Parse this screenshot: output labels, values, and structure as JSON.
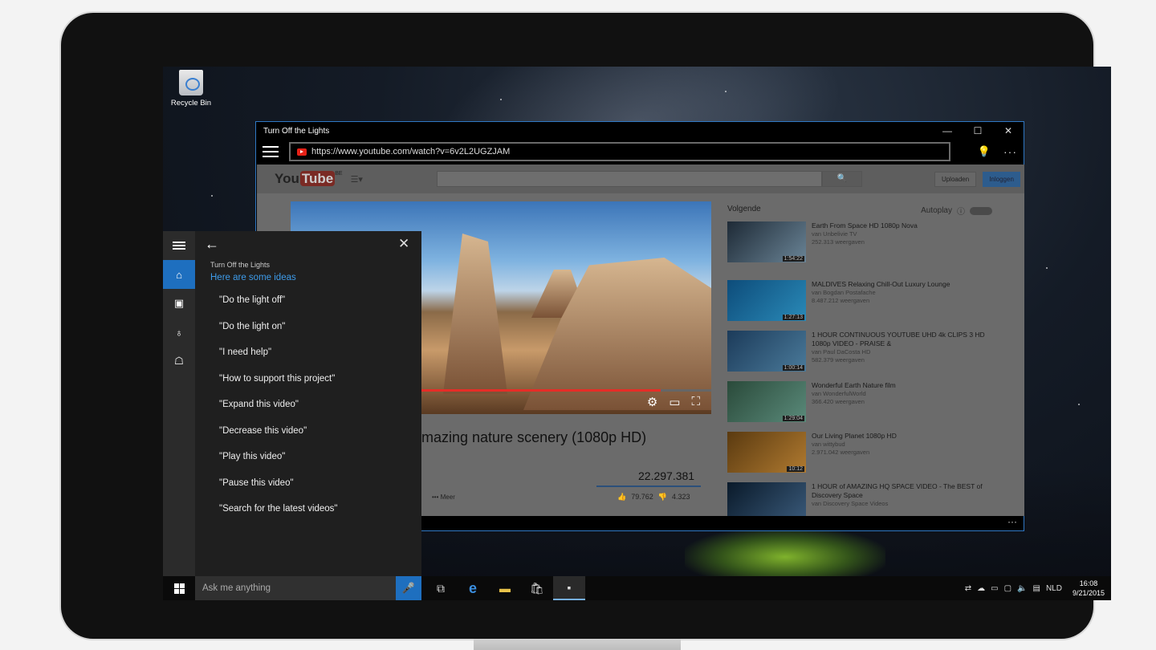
{
  "desktop": {
    "recycle_label": "Recycle Bin"
  },
  "window": {
    "title": "Turn Off the Lights",
    "controls": {
      "minimize": "—",
      "maximize": "☐",
      "close": "✕"
    },
    "url": "https://www.youtube.com/watch?v=6v2L2UGZJAM",
    "more": "···"
  },
  "youtube": {
    "logo_you": "You",
    "logo_tube": "Tube",
    "logo_region": "BE",
    "upload_label": "Uploaden",
    "login_label": "Inloggen",
    "video_title": "mazing nature scenery (1080p HD)",
    "views": "22.297.381",
    "more_label": "••• Meer",
    "likes": "79.762",
    "dislikes": "4.323",
    "next_label": "Volgende",
    "autoplay_label": "Autoplay",
    "related": [
      {
        "title": "Earth From Space HD 1080p Nova",
        "channel": "van Unbelivie TV",
        "views": "252.313 weergaven",
        "duration": "1:54:22"
      },
      {
        "title": "MALDIVES Relaxing Chill-Out Luxury Lounge",
        "channel": "van Bogdan Postafache",
        "views": "8.487.212 weergaven",
        "duration": "1:27:13"
      },
      {
        "title": "1 HOUR CONTINUOUS YOUTUBE UHD 4k CLIPS 3 HD 1080p VIDEO - PRAISE &",
        "channel": "van Paul DaCosta HD",
        "views": "582.379 weergaven",
        "duration": "1:00:14"
      },
      {
        "title": "Wonderful Earth Nature film",
        "channel": "van WonderfulWorld",
        "views": "366.420 weergaven",
        "duration": "1:29:04"
      },
      {
        "title": "Our Living Planet 1080p HD",
        "channel": "van wittybud",
        "views": "2.971.042 weergaven",
        "duration": "10:12"
      },
      {
        "title": "1 HOUR of AMAZING HQ SPACE VIDEO - The BEST of Discovery Space",
        "channel": "van Discovery Space Videos",
        "views": "",
        "duration": ""
      }
    ]
  },
  "cortana": {
    "app_name": "Turn Off the Lights",
    "heading": "Here are some ideas",
    "ideas": [
      "\"Do the light off\"",
      "\"Do the light on\"",
      "\"I need help\"",
      "\"How to support this project\"",
      "\"Expand this video\"",
      "\"Decrease this video\"",
      "\"Play this video\"",
      "\"Pause this video\"",
      "\"Search for the latest videos\""
    ]
  },
  "taskbar": {
    "search_placeholder": "Ask me anything",
    "language": "NLD",
    "time": "16:08",
    "date": "9/21/2015"
  },
  "colors": {
    "accent": "#1e6fbf",
    "link": "#3d9be9",
    "progress": "#e52d27"
  }
}
